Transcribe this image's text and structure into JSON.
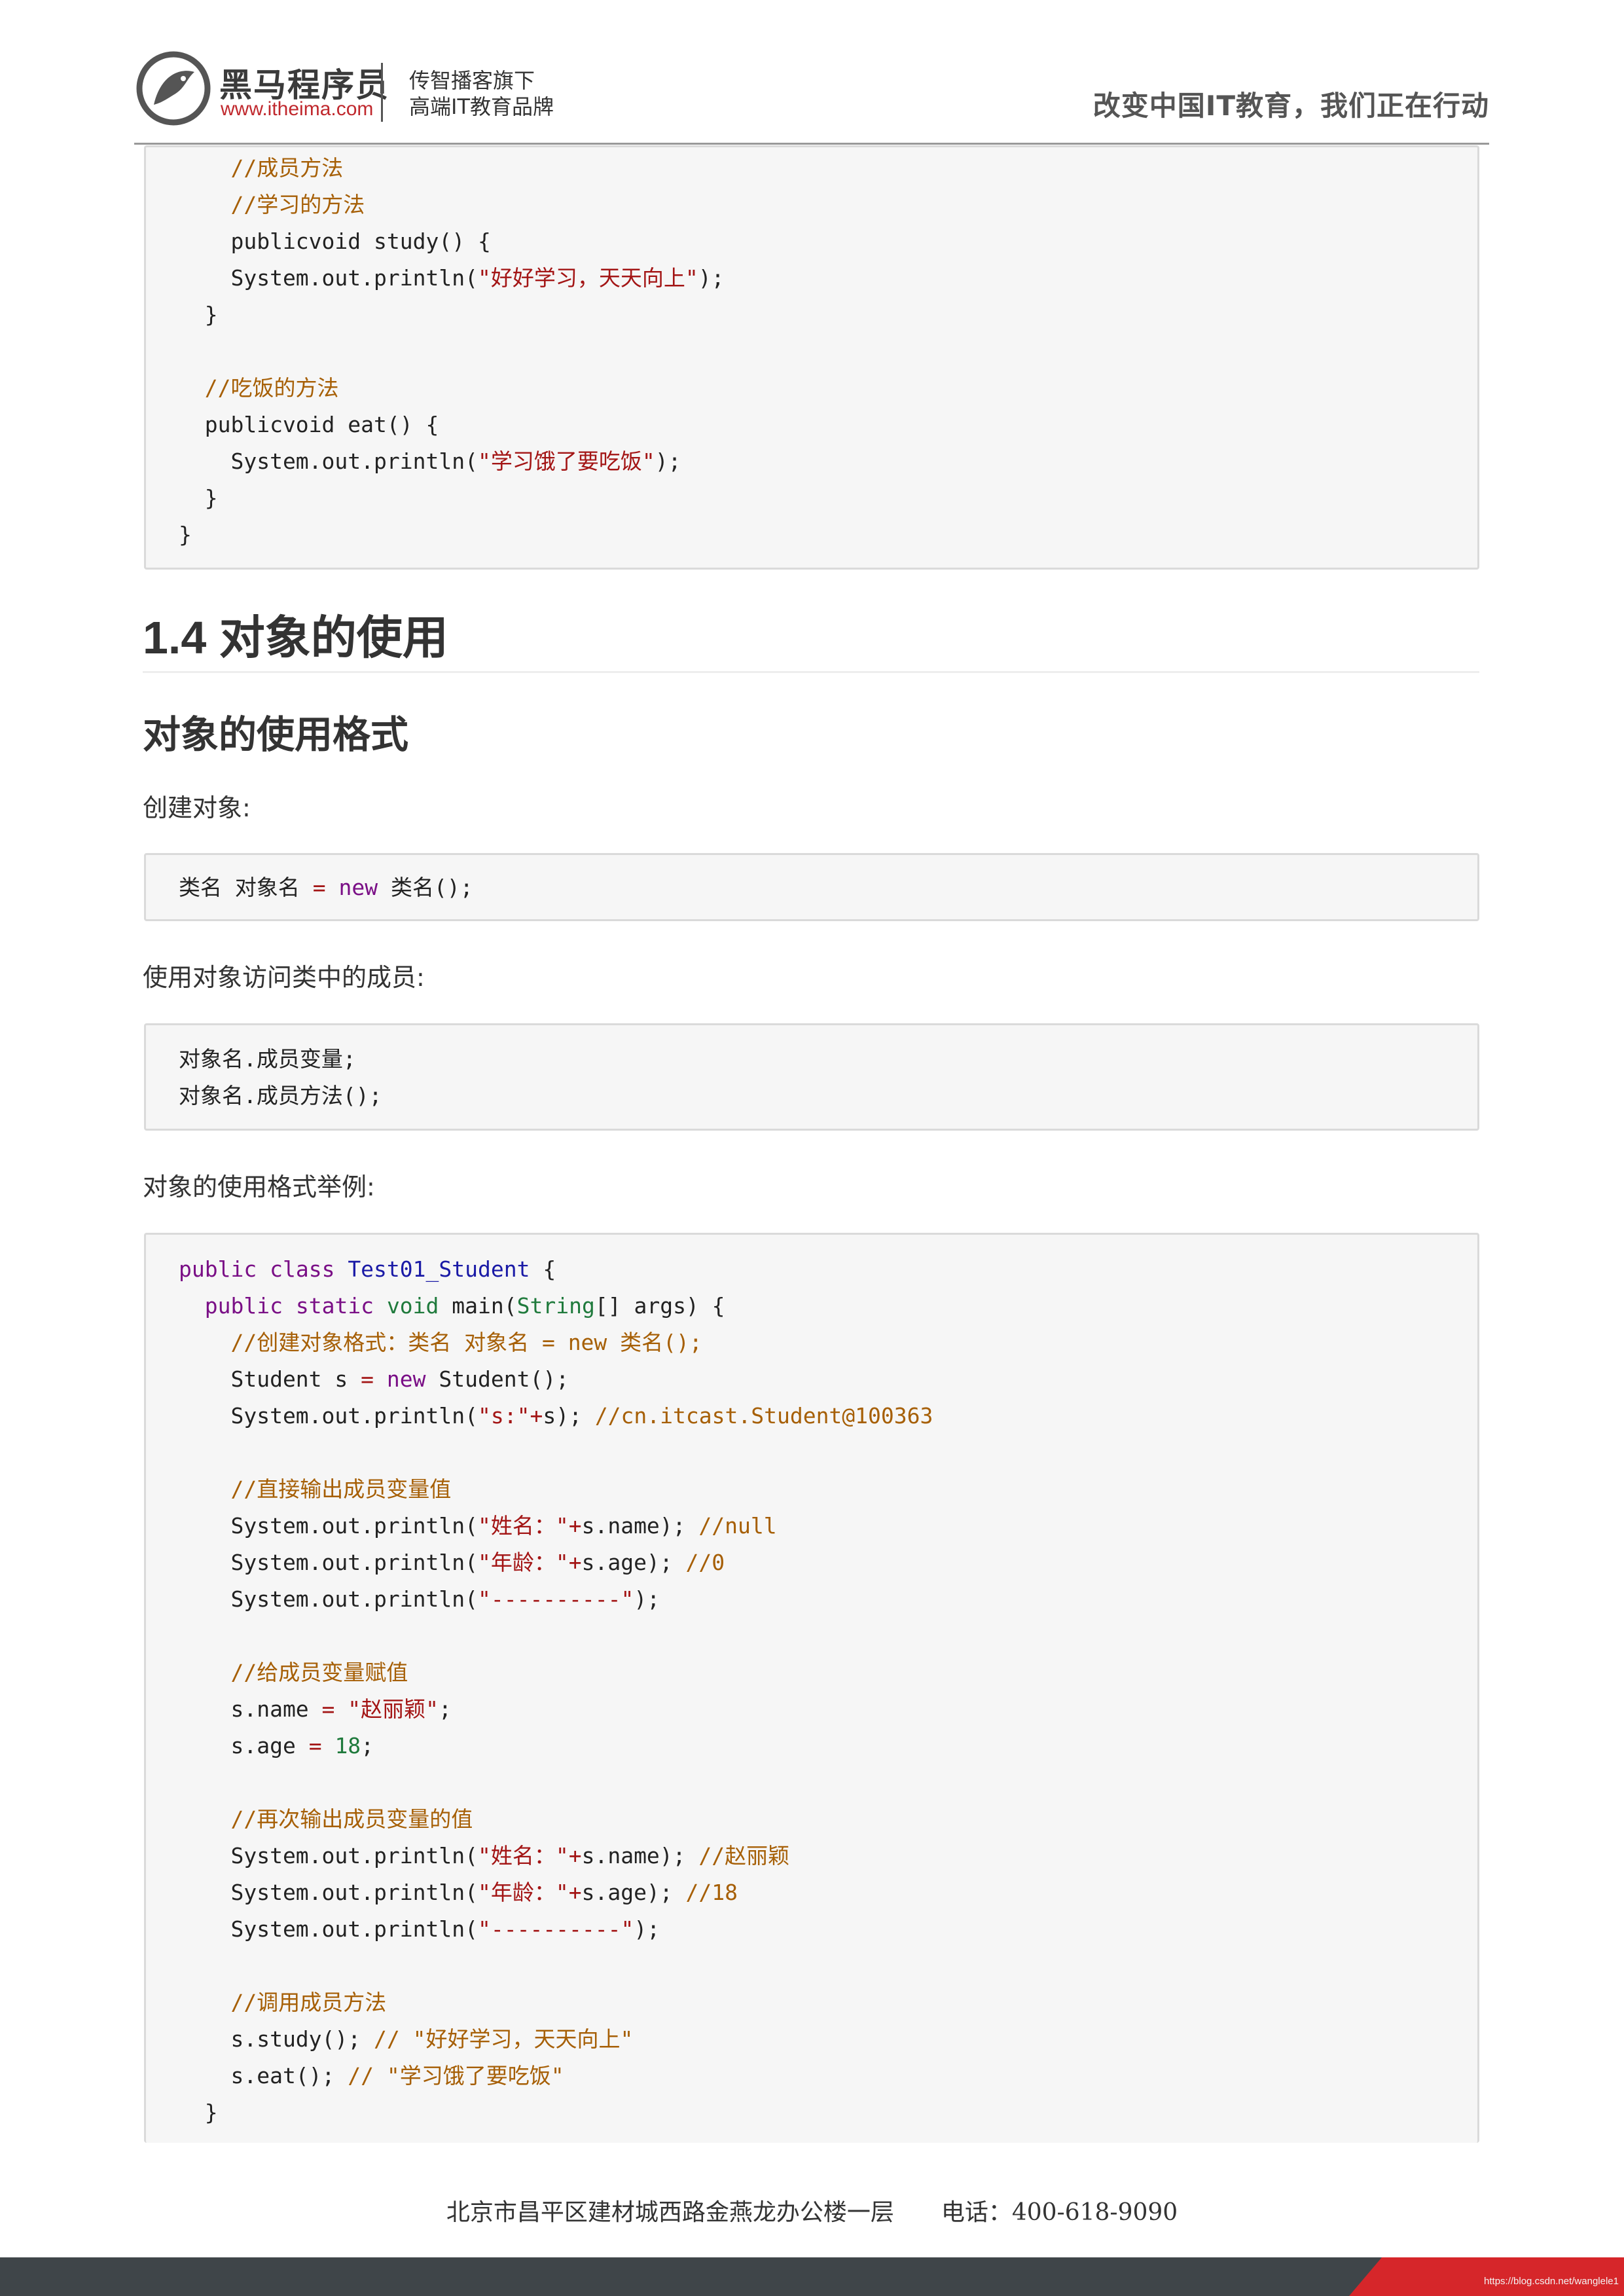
{
  "header": {
    "brand_name": "黑马程序员",
    "brand_url": "www.itheima.com",
    "slogan_line1": "传智播客旗下",
    "slogan_line2": "高端IT教育品牌",
    "motto": "改变中国IT教育，我们正在行动"
  },
  "code_top": {
    "lines": [
      [
        "    ",
        {
          "t": "//成员方法",
          "c": "com"
        }
      ],
      [
        "    ",
        {
          "t": "//学习的方法",
          "c": "com"
        }
      ],
      [
        "    publicvoid study() {"
      ],
      [
        "    System.out.println(",
        {
          "t": "\"好好学习，天天向上\"",
          "c": "str"
        },
        ");"
      ],
      [
        "  }"
      ],
      [
        ""
      ],
      [
        "  ",
        {
          "t": "//吃饭的方法",
          "c": "com"
        }
      ],
      [
        "  publicvoid eat() {"
      ],
      [
        "    System.out.println(",
        {
          "t": "\"学习饿了要吃饭\"",
          "c": "str"
        },
        ");"
      ],
      [
        "  }"
      ],
      [
        "}"
      ]
    ]
  },
  "section": {
    "heading": "1.4 对象的使用",
    "subheading": "对象的使用格式",
    "create_label": "创建对象:",
    "access_label": "使用对象访问类中的成员:",
    "example_label": "对象的使用格式举例:"
  },
  "code_create": {
    "lines": [
      [
        "类名 对象名 ",
        {
          "t": "=",
          "c": "op"
        },
        " ",
        {
          "t": "new",
          "c": "kw"
        },
        " 类名();"
      ]
    ]
  },
  "code_access": {
    "lines": [
      [
        "对象名.成员变量;"
      ],
      [
        "对象名.成员方法();"
      ]
    ]
  },
  "code_example": {
    "lines": [
      [
        {
          "t": "public",
          "c": "kw"
        },
        " ",
        {
          "t": "class",
          "c": "kw"
        },
        " ",
        {
          "t": "Test01_Student",
          "c": "type"
        },
        " {"
      ],
      [
        "  ",
        {
          "t": "public",
          "c": "kw"
        },
        " ",
        {
          "t": "static",
          "c": "kw"
        },
        " ",
        {
          "t": "void",
          "c": "void"
        },
        " main(",
        {
          "t": "String",
          "c": "void"
        },
        "[] args) {"
      ],
      [
        "    ",
        {
          "t": "//创建对象格式：类名 对象名 = new 类名();",
          "c": "com"
        }
      ],
      [
        "    Student s ",
        {
          "t": "=",
          "c": "op"
        },
        " ",
        {
          "t": "new",
          "c": "kw"
        },
        " Student();"
      ],
      [
        "    System.out.println(",
        {
          "t": "\"s:\"",
          "c": "str"
        },
        {
          "t": "+",
          "c": "op"
        },
        "s); ",
        {
          "t": "//cn.itcast.Student@100363",
          "c": "com"
        }
      ],
      [
        ""
      ],
      [
        "    ",
        {
          "t": "//直接输出成员变量值",
          "c": "com"
        }
      ],
      [
        "    System.out.println(",
        {
          "t": "\"姓名：\"",
          "c": "str"
        },
        {
          "t": "+",
          "c": "op"
        },
        "s.name); ",
        {
          "t": "//null",
          "c": "com"
        }
      ],
      [
        "    System.out.println(",
        {
          "t": "\"年龄：\"",
          "c": "str"
        },
        {
          "t": "+",
          "c": "op"
        },
        "s.age); ",
        {
          "t": "//0",
          "c": "com"
        }
      ],
      [
        "    System.out.println(",
        {
          "t": "\"----------\"",
          "c": "str"
        },
        ");"
      ],
      [
        ""
      ],
      [
        "    ",
        {
          "t": "//给成员变量赋值",
          "c": "com"
        }
      ],
      [
        "    s.name ",
        {
          "t": "=",
          "c": "op"
        },
        " ",
        {
          "t": "\"赵丽颖\"",
          "c": "str"
        },
        ";"
      ],
      [
        "    s.age ",
        {
          "t": "=",
          "c": "op"
        },
        " ",
        {
          "t": "18",
          "c": "num"
        },
        ";"
      ],
      [
        ""
      ],
      [
        "    ",
        {
          "t": "//再次输出成员变量的值",
          "c": "com"
        }
      ],
      [
        "    System.out.println(",
        {
          "t": "\"姓名：\"",
          "c": "str"
        },
        {
          "t": "+",
          "c": "op"
        },
        "s.name); ",
        {
          "t": "//赵丽颖",
          "c": "com"
        }
      ],
      [
        "    System.out.println(",
        {
          "t": "\"年龄：\"",
          "c": "str"
        },
        {
          "t": "+",
          "c": "op"
        },
        "s.age); ",
        {
          "t": "//18",
          "c": "com"
        }
      ],
      [
        "    System.out.println(",
        {
          "t": "\"----------\"",
          "c": "str"
        },
        ");"
      ],
      [
        ""
      ],
      [
        "    ",
        {
          "t": "//调用成员方法",
          "c": "com"
        }
      ],
      [
        "    s.study(); ",
        {
          "t": "// \"好好学习，天天向上\"",
          "c": "com"
        }
      ],
      [
        "    s.eat(); ",
        {
          "t": "// \"学习饿了要吃饭\"",
          "c": "com"
        }
      ],
      [
        "  }"
      ]
    ]
  },
  "footer": {
    "address": "北京市昌平区建材城西路金燕龙办公楼一层　　电话：400-618-9090",
    "watermark": "https://blog.csdn.net/wanglele1"
  }
}
